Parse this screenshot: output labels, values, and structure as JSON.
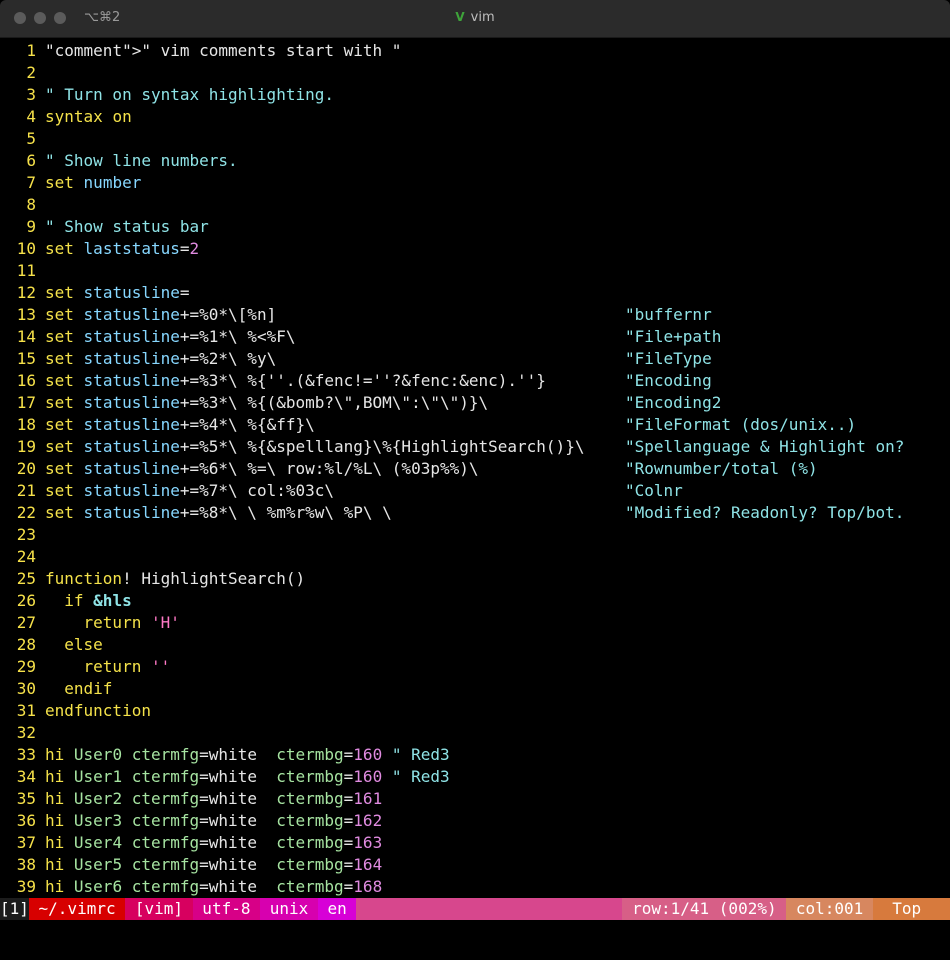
{
  "window": {
    "shortcut": "⌥⌘2",
    "title": "vim",
    "colors": {
      "titlebar": "#2b2b2b",
      "background": "#000000"
    }
  },
  "editor": {
    "lines": [
      {
        "n": "1",
        "text": "\" vim comments start with \""
      },
      {
        "n": "2",
        "text": ""
      },
      {
        "n": "3",
        "text": "\" Turn on syntax highlighting."
      },
      {
        "n": "4",
        "text": "syntax on"
      },
      {
        "n": "5",
        "text": ""
      },
      {
        "n": "6",
        "text": "\" Show line numbers."
      },
      {
        "n": "7",
        "text": "set number"
      },
      {
        "n": "8",
        "text": ""
      },
      {
        "n": "9",
        "text": "\" Show status bar"
      },
      {
        "n": "10",
        "text": "set laststatus=2"
      },
      {
        "n": "11",
        "text": ""
      },
      {
        "n": "12",
        "text": "set statusline="
      },
      {
        "n": "13",
        "text": "set statusline+=%0*\\[%n]",
        "comment": "\"buffernr"
      },
      {
        "n": "14",
        "text": "set statusline+=%1*\\ %<%F\\",
        "comment": "\"File+path"
      },
      {
        "n": "15",
        "text": "set statusline+=%2*\\ %y\\",
        "comment": "\"FileType"
      },
      {
        "n": "16",
        "text": "set statusline+=%3*\\ %{''.(&fenc!=''?&fenc:&enc).''}",
        "comment": "\"Encoding"
      },
      {
        "n": "17",
        "text": "set statusline+=%3*\\ %{(&bomb?\\\",BOM\\\":\\\"\\\")}\\",
        "comment": "\"Encoding2"
      },
      {
        "n": "18",
        "text": "set statusline+=%4*\\ %{&ff}\\",
        "comment": "\"FileFormat (dos/unix..)"
      },
      {
        "n": "19",
        "text": "set statusline+=%5*\\ %{&spelllang}\\%{HighlightSearch()}\\",
        "comment": "\"Spellanguage & Highlight on?"
      },
      {
        "n": "20",
        "text": "set statusline+=%6*\\ %=\\ row:%l/%L\\ (%03p%%)\\",
        "comment": "\"Rownumber/total (%)"
      },
      {
        "n": "21",
        "text": "set statusline+=%7*\\ col:%03c\\",
        "comment": "\"Colnr"
      },
      {
        "n": "22",
        "text": "set statusline+=%8*\\ \\ %m%r%w\\ %P\\ \\",
        "comment": "\"Modified? Readonly? Top/bot."
      },
      {
        "n": "23",
        "text": ""
      },
      {
        "n": "24",
        "text": ""
      },
      {
        "n": "25",
        "text": "function! HighlightSearch()"
      },
      {
        "n": "26",
        "text": "  if &hls"
      },
      {
        "n": "27",
        "text": "    return 'H'"
      },
      {
        "n": "28",
        "text": "  else"
      },
      {
        "n": "29",
        "text": "    return ''"
      },
      {
        "n": "30",
        "text": "  endif"
      },
      {
        "n": "31",
        "text": "endfunction"
      },
      {
        "n": "32",
        "text": ""
      },
      {
        "n": "33",
        "text": "hi User0 ctermfg=white  ctermbg=160 \" Red3"
      },
      {
        "n": "34",
        "text": "hi User1 ctermfg=white  ctermbg=160 \" Red3"
      },
      {
        "n": "35",
        "text": "hi User2 ctermfg=white  ctermbg=161"
      },
      {
        "n": "36",
        "text": "hi User3 ctermfg=white  ctermbg=162"
      },
      {
        "n": "37",
        "text": "hi User4 ctermfg=white  ctermbg=163"
      },
      {
        "n": "38",
        "text": "hi User5 ctermfg=white  ctermbg=164"
      },
      {
        "n": "39",
        "text": "hi User6 ctermfg=white  ctermbg=168"
      }
    ]
  },
  "statusbar": {
    "buffer": "[1]",
    "file": " ~/.vimrc ",
    "filetype": " [vim] ",
    "encoding": " utf-8 ",
    "format": " unix ",
    "spelllang": " en ",
    "row": " row:1/41 (002%) ",
    "col": " col:001 ",
    "position": "  Top   "
  }
}
